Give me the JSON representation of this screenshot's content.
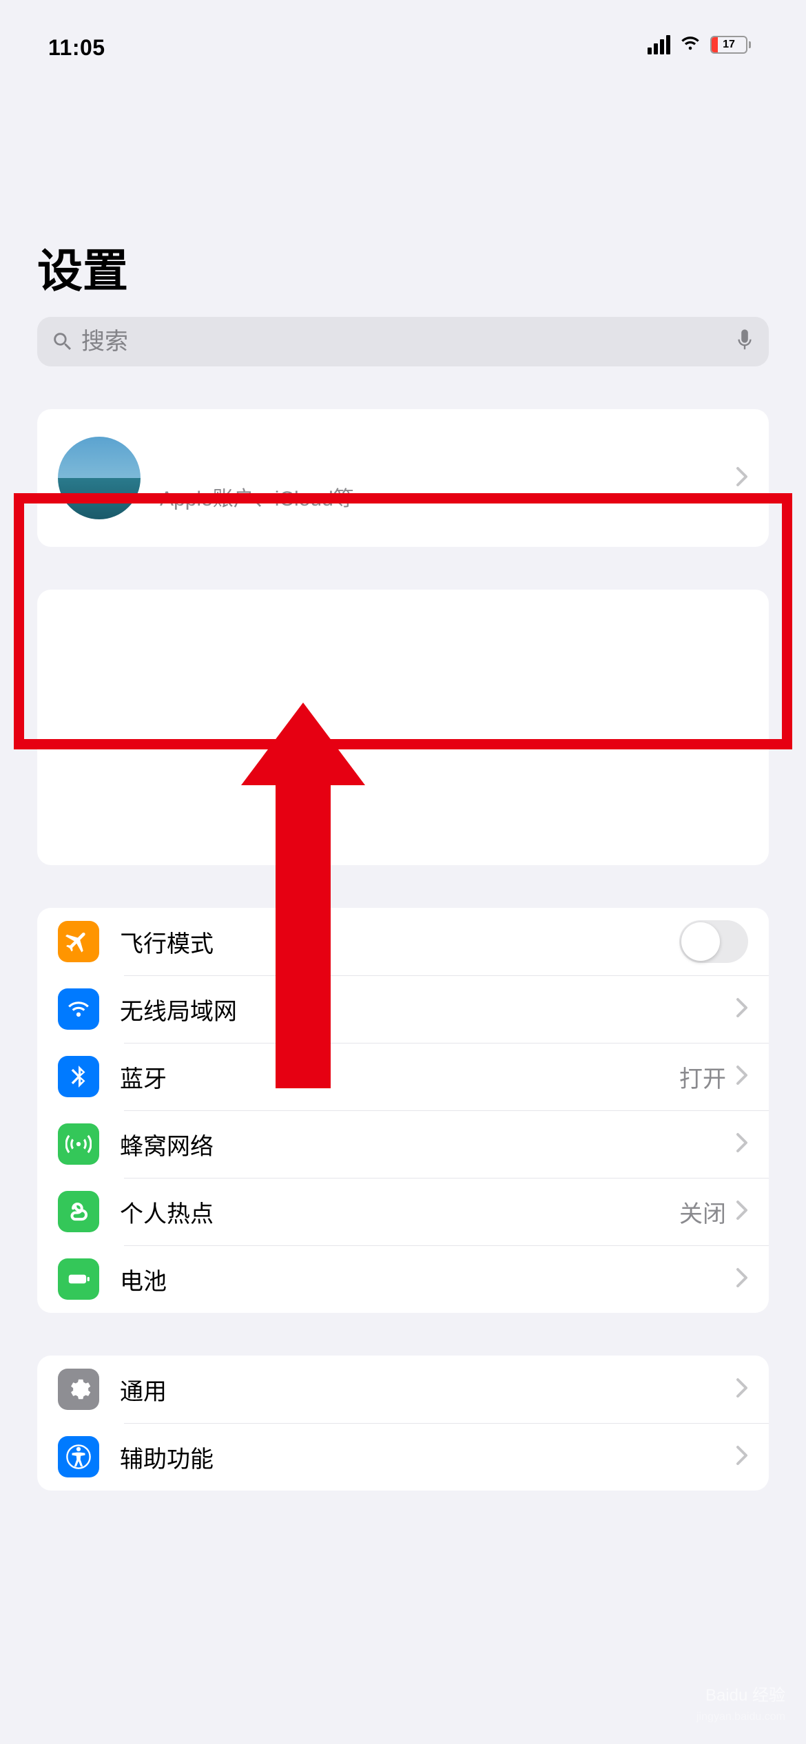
{
  "status": {
    "time": "11:05",
    "battery_pct": "17"
  },
  "title": "设置",
  "search": {
    "placeholder": "搜索"
  },
  "account": {
    "subtitle": "Apple账户、iCloud等"
  },
  "rows": {
    "airplane": {
      "label": "飞行模式"
    },
    "wifi": {
      "label": "无线局域网",
      "value": ""
    },
    "bluetooth": {
      "label": "蓝牙",
      "value": "打开"
    },
    "cellular": {
      "label": "蜂窝网络"
    },
    "hotspot": {
      "label": "个人热点",
      "value": "关闭"
    },
    "battery": {
      "label": "电池"
    },
    "general": {
      "label": "通用"
    },
    "accessibility": {
      "label": "辅助功能"
    }
  },
  "watermark": "Baidu 经验"
}
